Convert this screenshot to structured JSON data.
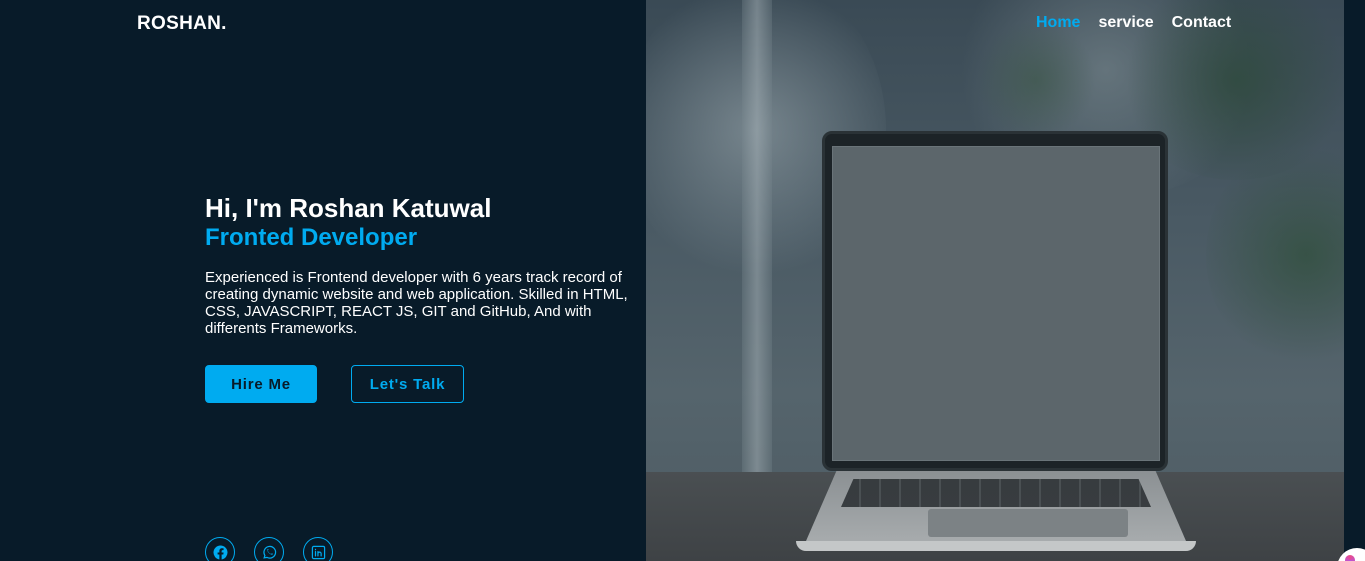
{
  "header": {
    "logo": "ROSHAN.",
    "nav": [
      {
        "label": "Home",
        "active": true
      },
      {
        "label": "service",
        "active": false
      },
      {
        "label": "Contact",
        "active": false
      }
    ]
  },
  "hero": {
    "title": "Hi, I'm Roshan Katuwal",
    "role": "Fronted Developer",
    "description": "Experienced is Frontend developer with 6 years track record of creating dynamic website and web application. Skilled in HTML, CSS, JAVASCRIPT, REACT JS, GIT and GitHub, And with differents Frameworks.",
    "buttons": {
      "hire": "Hire Me",
      "talk": "Let's Talk"
    }
  },
  "socials": [
    "facebook-icon",
    "whatsapp-icon",
    "linkedin-icon"
  ],
  "colors": {
    "background": "#081b29",
    "accent": "#00abf0",
    "text": "#ffffff"
  }
}
